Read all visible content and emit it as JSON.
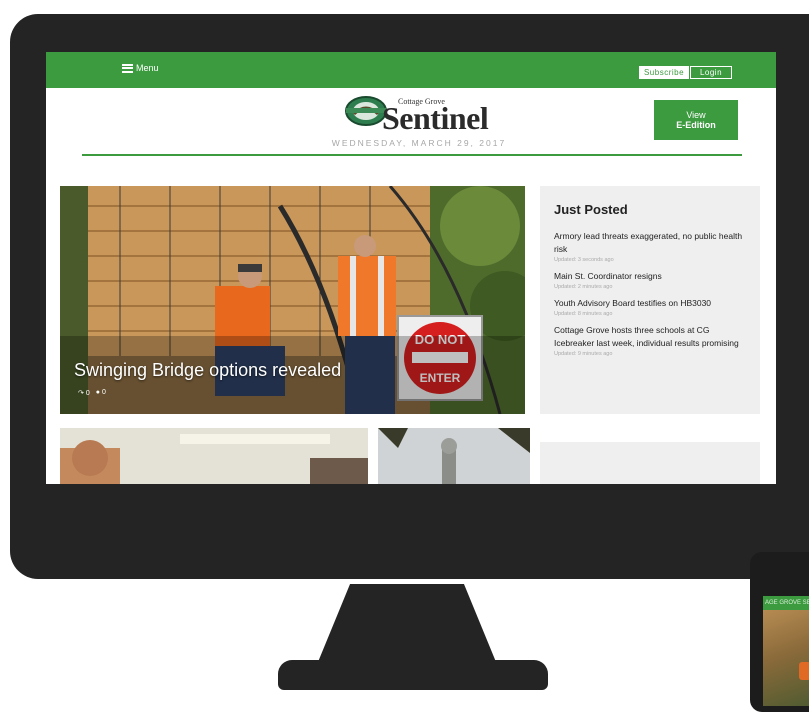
{
  "topbar": {
    "menu_label": "Menu",
    "subscribe_label": "Subscribe",
    "login_label": "Login"
  },
  "masthead": {
    "logo_small": "Cottage Grove",
    "logo_big": "Sentinel",
    "dateline": "WEDNESDAY, MARCH 29, 2017",
    "eedition_line1": "View",
    "eedition_line2": "E-Edition"
  },
  "hero": {
    "headline": "Swinging Bridge options revealed",
    "shares": "0",
    "comments": "0",
    "sign_line1": "DO NOT",
    "sign_line2": "ENTER"
  },
  "just_posted": {
    "title": "Just Posted",
    "items": [
      {
        "headline": "Armory lead threats exaggerated, no public health risk",
        "time": "Updated: 3 seconds ago"
      },
      {
        "headline": "Main St. Coordinator resigns",
        "time": "Updated: 2 minutes ago"
      },
      {
        "headline": "Youth Advisory Board testifies on HB3030",
        "time": "Updated: 8 minutes ago"
      },
      {
        "headline": "Cottage Grove hosts three schools at CG Icebreaker last week, individual results promising",
        "time": "Updated: 9 minutes ago"
      }
    ]
  },
  "phone": {
    "bar_text": "AGE GROVE SEN"
  },
  "colors": {
    "accent_green": "#3c9a3f",
    "device_body": "#242424",
    "panel_gray": "#efefef"
  }
}
